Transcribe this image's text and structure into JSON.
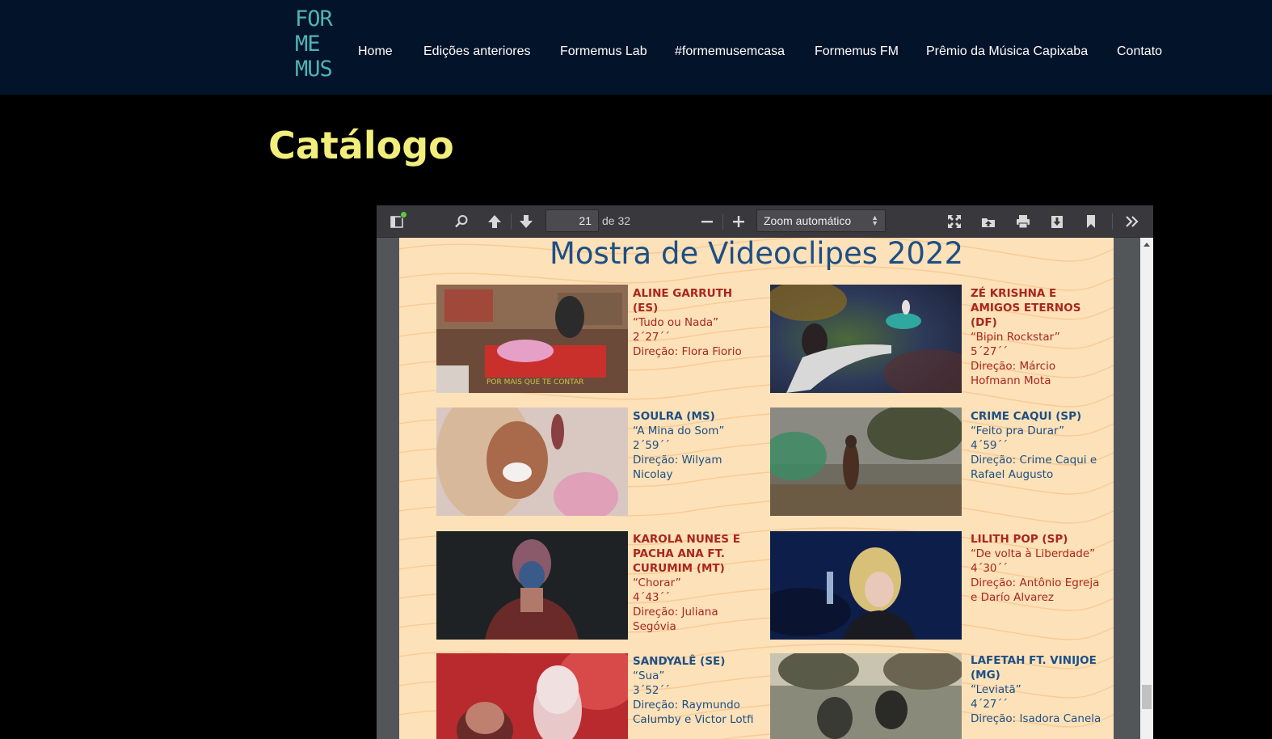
{
  "header": {
    "logo_lines": [
      "FOR",
      "ME",
      "MUS"
    ],
    "nav": [
      "Home",
      "Edições anteriores",
      "Formemus Lab",
      "#formemusemcasa",
      "Formemus FM",
      "Prêmio da Música Capixaba",
      "Contato"
    ]
  },
  "page_title": "Catálogo",
  "viewer": {
    "page_current": "21",
    "page_count_label": "de 32",
    "zoom_label": "Zoom automático"
  },
  "pdf": {
    "title": "Mostra de Videoclipes 2022",
    "entries": [
      {
        "artist": "ALINE GARRUTH (ES)",
        "song": "“Tudo ou Nada”",
        "duration": "2´27´´",
        "direction": "Direção: Flora Fiorio",
        "caption": "POR MAIS QUE TE CONTAR"
      },
      {
        "artist": "ZÉ KRISHNA E AMIGOS ETERNOS (DF)",
        "song": "“Bipin Rockstar”",
        "duration": "5´27´´",
        "direction": "Direção: Márcio Hofmann Mota"
      },
      {
        "artist": "SOULRA (MS)",
        "song": "“A Mina do Som”",
        "duration": "2´59´´",
        "direction": "Direção: Wilyam Nicolay"
      },
      {
        "artist": "CRIME CAQUI (SP)",
        "song": "“Feito pra Durar”",
        "duration": "4´59´´",
        "direction": "Direção: Crime Caqui e Rafael Augusto"
      },
      {
        "artist": "KAROLA NUNES E PACHA ANA FT. CURUMIM (MT)",
        "song": "“Chorar”",
        "duration": "4´43´´",
        "direction": "Direção: Juliana Segóvia"
      },
      {
        "artist": "LILITH POP (SP)",
        "song": "“De volta à Liberdade”",
        "duration": "4´30´´",
        "direction": "Direção: Antônio Egreja e Darío Alvarez"
      },
      {
        "artist": "SANDYALÊ (SE)",
        "song": "“Sua”",
        "duration": "3´52´´",
        "direction": "Direção: Raymundo Calumby e Victor Lotfi"
      },
      {
        "artist": "LAFETAH FT. VINIJOE (MG)",
        "song": "“Leviatã”",
        "duration": "4´27´´",
        "direction": "Direção: Isadora Canela"
      }
    ]
  },
  "colors": {
    "header_bg": "#031329",
    "logo": "#4fb3b6",
    "title": "#f2ee7c",
    "pdf_bg": "#fde1b8",
    "pdf_red": "#a8261e",
    "pdf_blue": "#1d4f86"
  }
}
